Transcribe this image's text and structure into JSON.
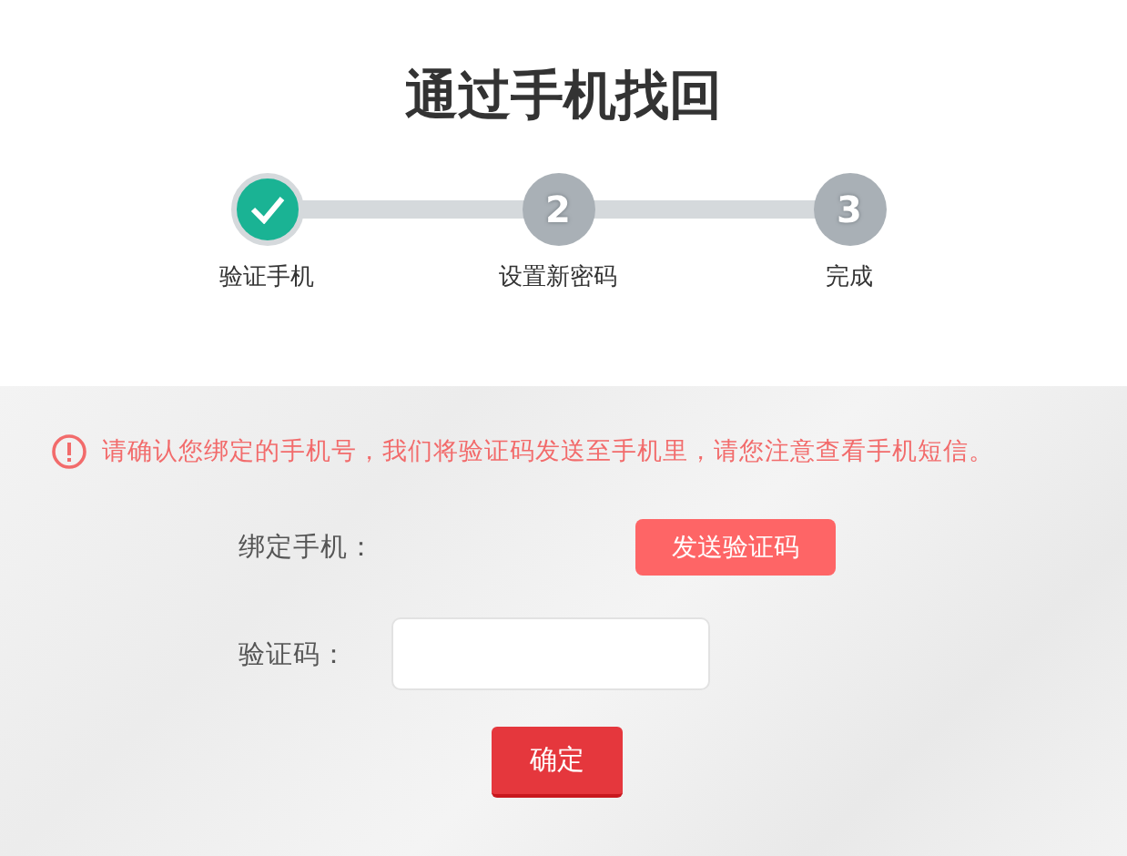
{
  "title": "通过手机找回",
  "steps": [
    {
      "label": "验证手机",
      "done": true
    },
    {
      "label": "设置新密码",
      "number": "2",
      "done": false
    },
    {
      "label": "完成",
      "number": "3",
      "done": false
    }
  ],
  "notice": "请确认您绑定的手机号，我们将验证码发送至手机里，请您注意查看手机短信。",
  "form": [
    {
      "kind": "button",
      "label": "绑定手机：",
      "button": "发送验证码"
    },
    {
      "kind": "input",
      "label": "验证码："
    }
  ],
  "submit": "确定"
}
